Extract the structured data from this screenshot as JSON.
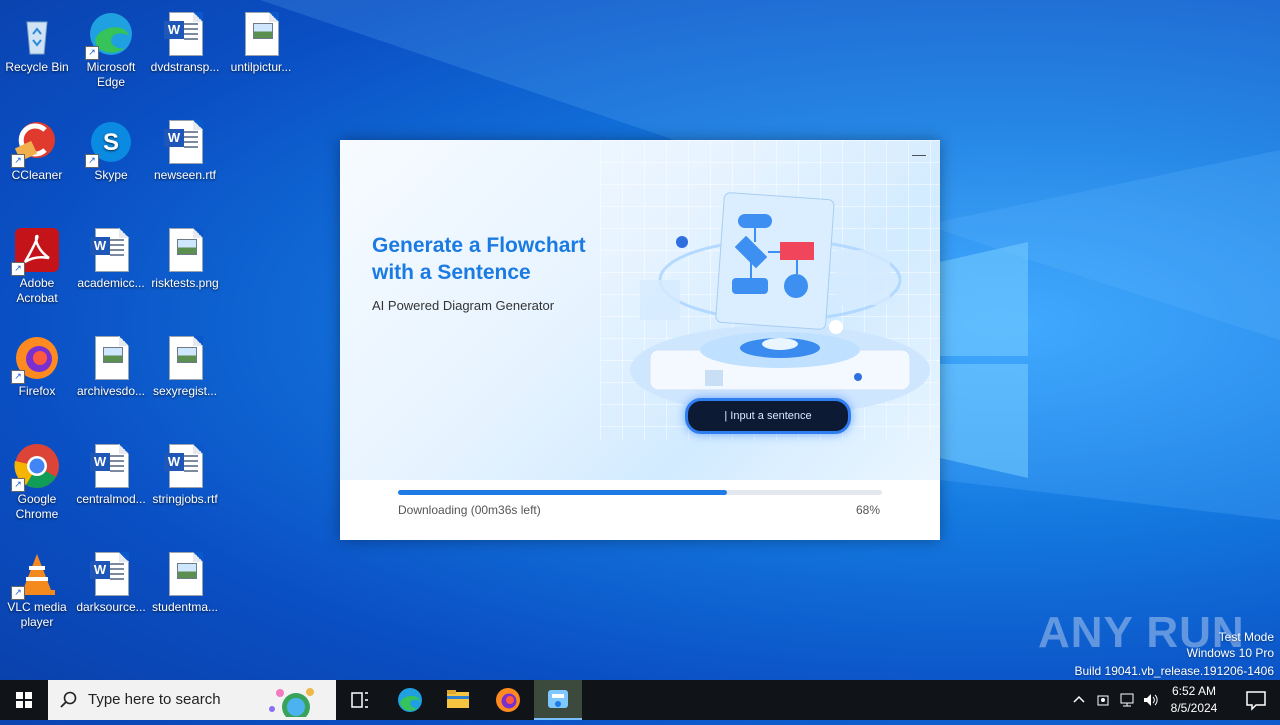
{
  "desktop": {
    "icons": [
      {
        "label": "Recycle Bin"
      },
      {
        "label": "Microsoft Edge"
      },
      {
        "label": "dvdstransp..."
      },
      {
        "label": "untilpictur..."
      },
      {
        "label": "CCleaner"
      },
      {
        "label": "Skype"
      },
      {
        "label": "newseen.rtf"
      },
      {
        "label": "Adobe Acrobat"
      },
      {
        "label": "academicc..."
      },
      {
        "label": "risktests.png"
      },
      {
        "label": "Firefox"
      },
      {
        "label": "archivesdo..."
      },
      {
        "label": "sexyregist..."
      },
      {
        "label": "Google Chrome"
      },
      {
        "label": "centralmod..."
      },
      {
        "label": "stringjobs.rtf"
      },
      {
        "label": "VLC media player"
      },
      {
        "label": "darksource..."
      },
      {
        "label": "studentma..."
      }
    ]
  },
  "dialog": {
    "minimize_glyph": "—",
    "title": "Generate a Flowchart with a Sentence",
    "subtitle": "AI Powered Diagram Generator",
    "input_pill": "| Input a sentence",
    "progress": {
      "fraction": 0.68,
      "status": "Downloading (00m36s left)",
      "percent_label": "68%"
    }
  },
  "watermark": {
    "brand": "ANY RUN",
    "mode": "Test Mode",
    "os": "Windows 10 Pro",
    "build": "Build 19041.vb_release.191206-1406"
  },
  "taskbar": {
    "search_placeholder": "Type here to search",
    "clock_time": "6:52 AM",
    "clock_date": "8/5/2024"
  },
  "colors": {
    "accent": "#1b7be3",
    "progress_fill": "#1e7be6",
    "taskbar": "#101318"
  }
}
